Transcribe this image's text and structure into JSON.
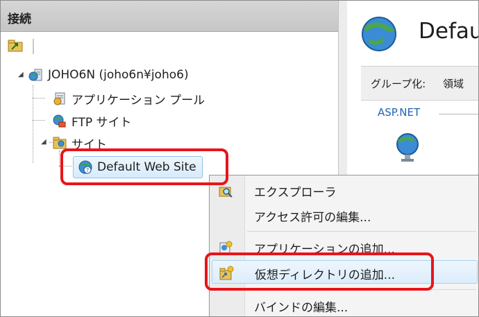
{
  "connections": {
    "header": "接続"
  },
  "tree": {
    "server": "JOHO6N (joho6n¥joho6)",
    "app_pools": "アプリケーション プール",
    "ftp_sites": "FTP サイト",
    "sites": "サイト",
    "default_site": "Default Web Site"
  },
  "right_pane": {
    "title": "Defau",
    "group_label": "グループ化:",
    "group_value": "領域",
    "section_label": "ASP.NET"
  },
  "context_menu": {
    "items": [
      {
        "label": "エクスプローラ",
        "icon": "explorer-icon"
      },
      {
        "label": "アクセス許可の編集...",
        "icon": ""
      },
      {
        "label": "アプリケーションの追加...",
        "icon": "add-application-icon"
      },
      {
        "label": "仮想ディレクトリの追加...",
        "icon": "add-virtual-directory-icon"
      },
      {
        "label": "バインドの編集...",
        "icon": ""
      }
    ],
    "highlighted_index": 3
  },
  "colors": {
    "annotation_red": "#e8141b",
    "selection_blue": "#d7ebfb",
    "link_blue": "#1f63b5"
  }
}
